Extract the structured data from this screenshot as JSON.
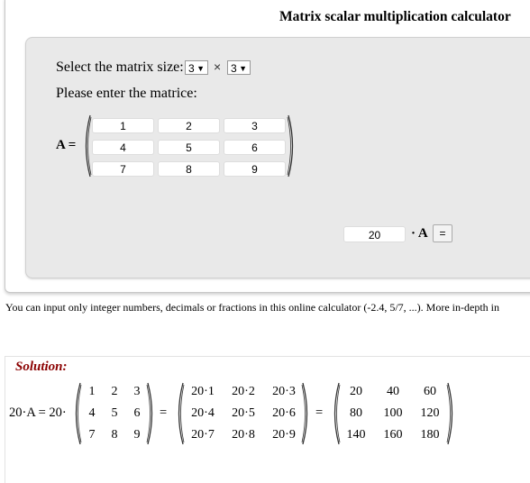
{
  "header": {
    "title": "Matrix scalar multiplication calculator"
  },
  "form": {
    "size_label": "Select the matrix size:",
    "rows_value": "3",
    "cols_value": "3",
    "times_symbol": "×",
    "enter_label": "Please enter the matrice:",
    "matrix_label": "A =",
    "matrix": [
      [
        "1",
        "2",
        "3"
      ],
      [
        "4",
        "5",
        "6"
      ],
      [
        "7",
        "8",
        "9"
      ]
    ],
    "scalar": "20",
    "dot_a": "· A",
    "equals_button": "="
  },
  "note": "You can input only integer numbers, decimals or fractions in this online calculator (-2.4, 5/7, ...). More in-depth in",
  "solution": {
    "title": "Solution:",
    "lhs": "20·A = 20·",
    "eq1": "=",
    "eq2": "=",
    "matrix_a": [
      [
        "1",
        "2",
        "3"
      ],
      [
        "4",
        "5",
        "6"
      ],
      [
        "7",
        "8",
        "9"
      ]
    ],
    "matrix_expr": [
      [
        "20·1",
        "20·2",
        "20·3"
      ],
      [
        "20·4",
        "20·5",
        "20·6"
      ],
      [
        "20·7",
        "20·8",
        "20·9"
      ]
    ],
    "matrix_result": [
      [
        "20",
        "40",
        "60"
      ],
      [
        "80",
        "100",
        "120"
      ],
      [
        "140",
        "160",
        "180"
      ]
    ]
  }
}
